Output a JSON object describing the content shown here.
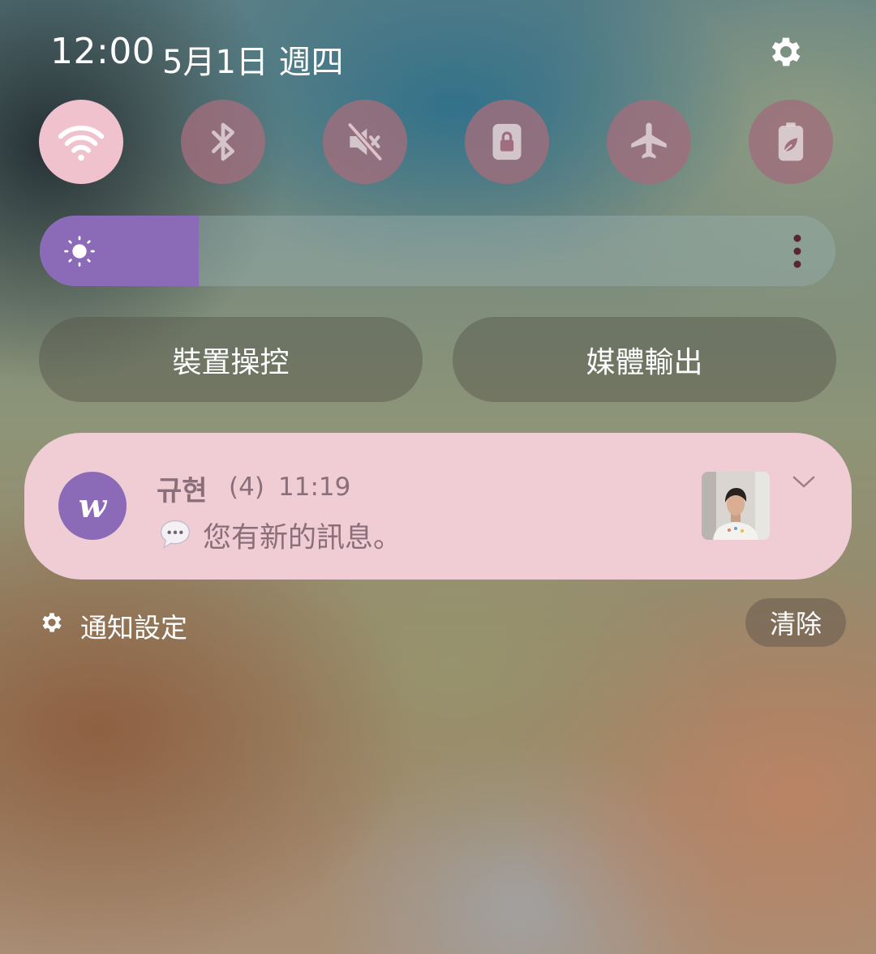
{
  "status": {
    "time": "12:00",
    "date": "5月1日 週四"
  },
  "quick_settings": [
    {
      "icon": "wifi-icon",
      "active": true
    },
    {
      "icon": "bluetooth-icon",
      "active": false
    },
    {
      "icon": "sound-off-icon",
      "active": false
    },
    {
      "icon": "rotation-lock-icon",
      "active": false
    },
    {
      "icon": "airplane-icon",
      "active": false
    },
    {
      "icon": "power-saving-icon",
      "active": false
    }
  ],
  "brightness": {
    "level": 0.2,
    "icon": "sun-icon"
  },
  "pills": {
    "device_control": "裝置操控",
    "media_output": "媒體輸出"
  },
  "notification": {
    "app_icon_letter": "w",
    "title": "규현",
    "count": "(4)",
    "time": "11:19",
    "body": "您有新的訊息。"
  },
  "footer": {
    "settings_label": "通知設定",
    "clear_label": "清除"
  },
  "colors": {
    "active_tile": "#efc2ce",
    "inactive_tile": "#a06e7d",
    "accent": "#8b6ab8",
    "card": "#f0ccd5"
  }
}
